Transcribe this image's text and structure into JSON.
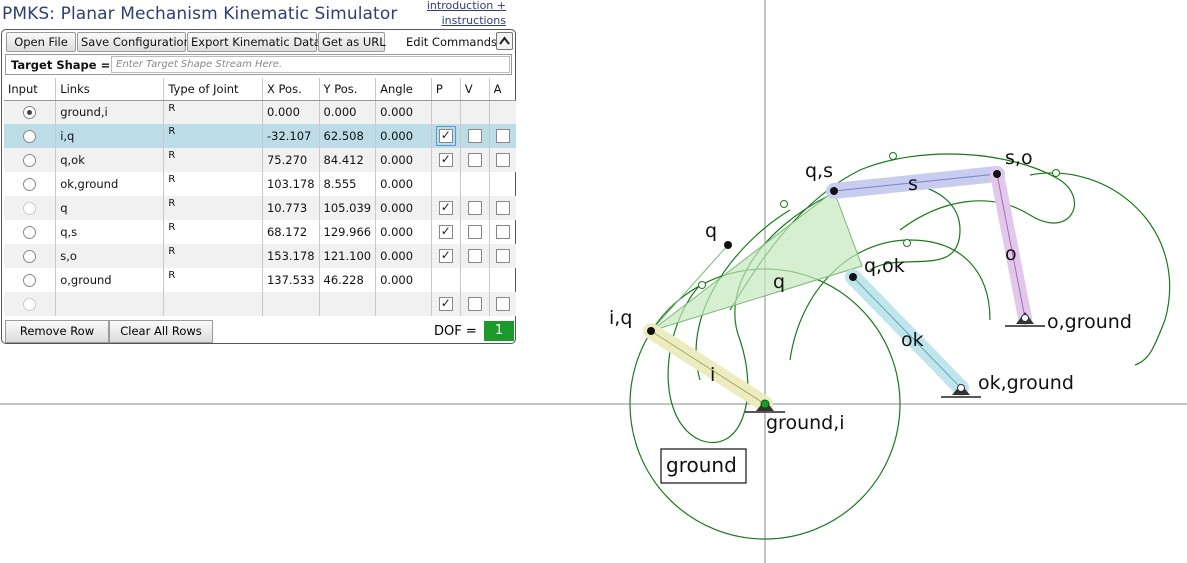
{
  "app": {
    "title": "PMKS: Planar Mechanism Kinematic Simulator",
    "intro_link_line1": "introduction +",
    "intro_link_line2": "instructions"
  },
  "toolbar": {
    "open_file": "Open File",
    "save_config": "Save Configuration",
    "export": "Export Kinematic Data",
    "get_url": "Get as URL",
    "edit_commands": "Edit Commands"
  },
  "target": {
    "label": "Target Shape =",
    "placeholder": "Enter Target Shape Stream Here."
  },
  "table": {
    "headers": [
      "Input",
      "Links",
      "Type of Joint",
      "X Pos.",
      "Y Pos.",
      "Angle",
      "P",
      "V",
      "A"
    ],
    "rows": [
      {
        "links": "ground,i",
        "type": "R",
        "x": "0.000",
        "y": "0.000",
        "angle": "0.000",
        "input_selected": true
      },
      {
        "links": "i,q",
        "type": "R",
        "x": "-32.107",
        "y": "62.508",
        "angle": "0.000",
        "p": true
      },
      {
        "links": "q,ok",
        "type": "R",
        "x": "75.270",
        "y": "84.412",
        "angle": "0.000",
        "p": true
      },
      {
        "links": "ok,ground",
        "type": "R",
        "x": "103.178",
        "y": "8.555",
        "angle": "0.000"
      },
      {
        "links": "q",
        "type": "R",
        "x": "10.773",
        "y": "105.039",
        "angle": "0.000",
        "p": true
      },
      {
        "links": "q,s",
        "type": "R",
        "x": "68.172",
        "y": "129.966",
        "angle": "0.000",
        "p": true
      },
      {
        "links": "s,o",
        "type": "R",
        "x": "153.178",
        "y": "121.100",
        "angle": "0.000",
        "p": true
      },
      {
        "links": "o,ground",
        "type": "R",
        "x": "137.533",
        "y": "46.228",
        "angle": "0.000"
      },
      {
        "links": "",
        "type": "",
        "x": "",
        "y": "",
        "angle": "",
        "p": true
      }
    ]
  },
  "bottom": {
    "remove_row": "Remove Row",
    "clear_all": "Clear All Rows",
    "dof_label": "DOF =",
    "dof_value": "1"
  },
  "canvas": {
    "joint_labels": [
      "q,s",
      "s,o",
      "q",
      "q,ok",
      "i,q",
      "o,ground",
      "ok,ground",
      "ground,i"
    ],
    "link_labels": [
      "s",
      "o",
      "q",
      "ok",
      "i"
    ],
    "ground_box": "ground",
    "colors": {
      "link_s": "#c8cdf0",
      "link_o": "#e4c8ec",
      "link_q": "#c4e8bc",
      "link_ok": "#bfe6ec",
      "link_i": "#ececc0",
      "path": "#1a7a1a",
      "dof_badge": "#1a9a2a"
    }
  }
}
